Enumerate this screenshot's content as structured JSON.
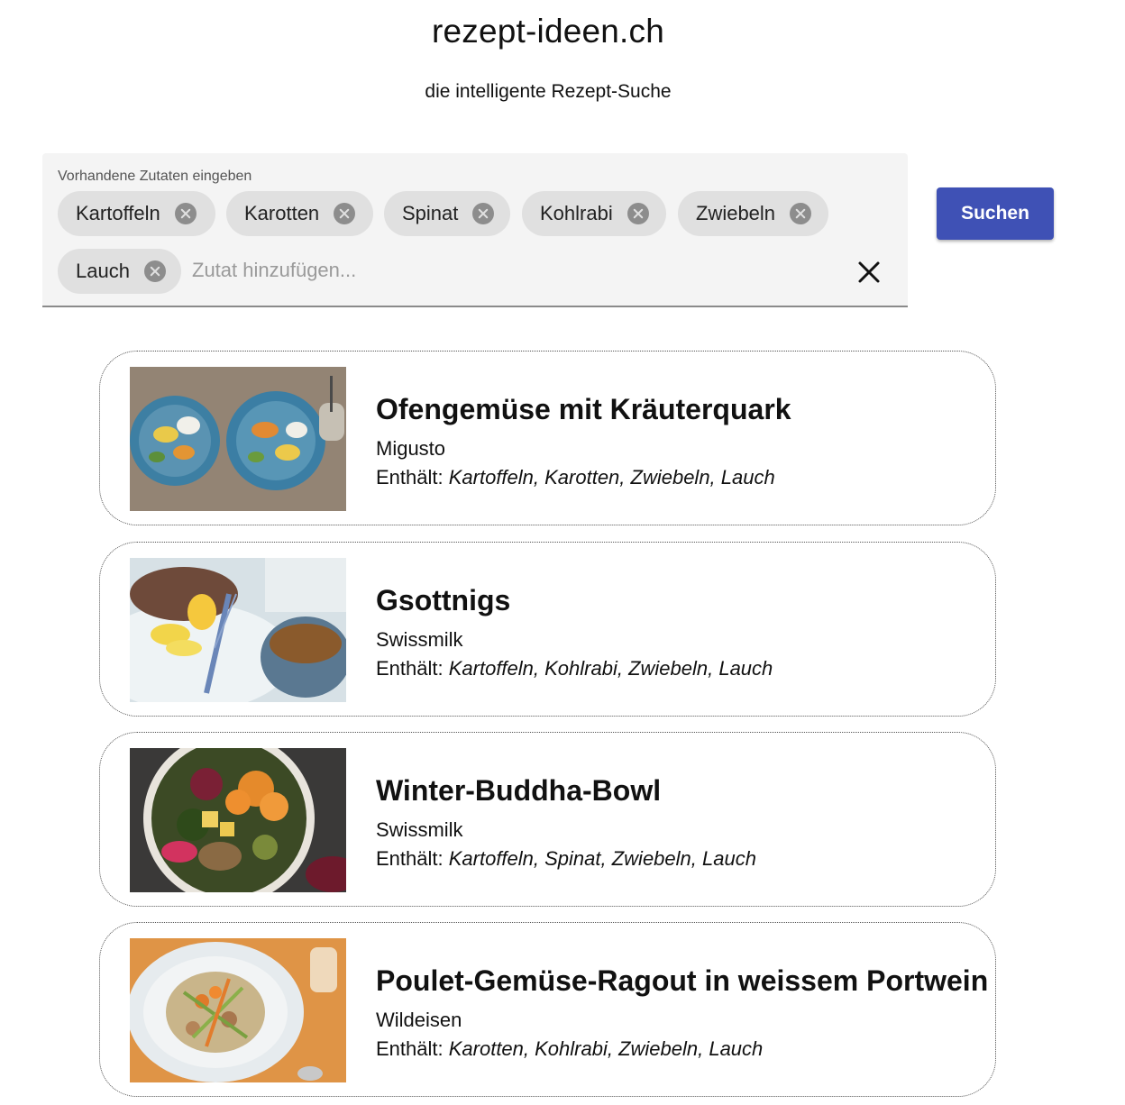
{
  "header": {
    "title": "rezept-ideen.ch",
    "subtitle": "die intelligente Rezept-Suche"
  },
  "search": {
    "label": "Vorhandene Zutaten eingeben",
    "chips": [
      "Kartoffeln",
      "Karotten",
      "Spinat",
      "Kohlrabi",
      "Zwiebeln",
      "Lauch"
    ],
    "placeholder": "Zutat hinzufügen...",
    "button_label": "Suchen"
  },
  "recipes": [
    {
      "title": "Ofengemüse mit Kräuterquark",
      "source": "Migusto",
      "contains_label": "Enthält:",
      "ingredients": "Kartoffeln, Karotten, Zwiebeln, Lauch"
    },
    {
      "title": "Gsottnigs",
      "source": "Swissmilk",
      "contains_label": "Enthält:",
      "ingredients": "Kartoffeln, Kohlrabi, Zwiebeln, Lauch"
    },
    {
      "title": "Winter-Buddha-Bowl",
      "source": "Swissmilk",
      "contains_label": "Enthält:",
      "ingredients": "Kartoffeln, Spinat, Zwiebeln, Lauch"
    },
    {
      "title": "Poulet-Gemüse-Ragout in weissem Portwein",
      "source": "Wildeisen",
      "contains_label": "Enthält:",
      "ingredients": "Karotten, Kohlrabi, Zwiebeln, Lauch"
    }
  ],
  "colors": {
    "primary_button": "#3f51b5",
    "chip_background": "#e0e0e0",
    "search_background": "#f4f4f4"
  }
}
